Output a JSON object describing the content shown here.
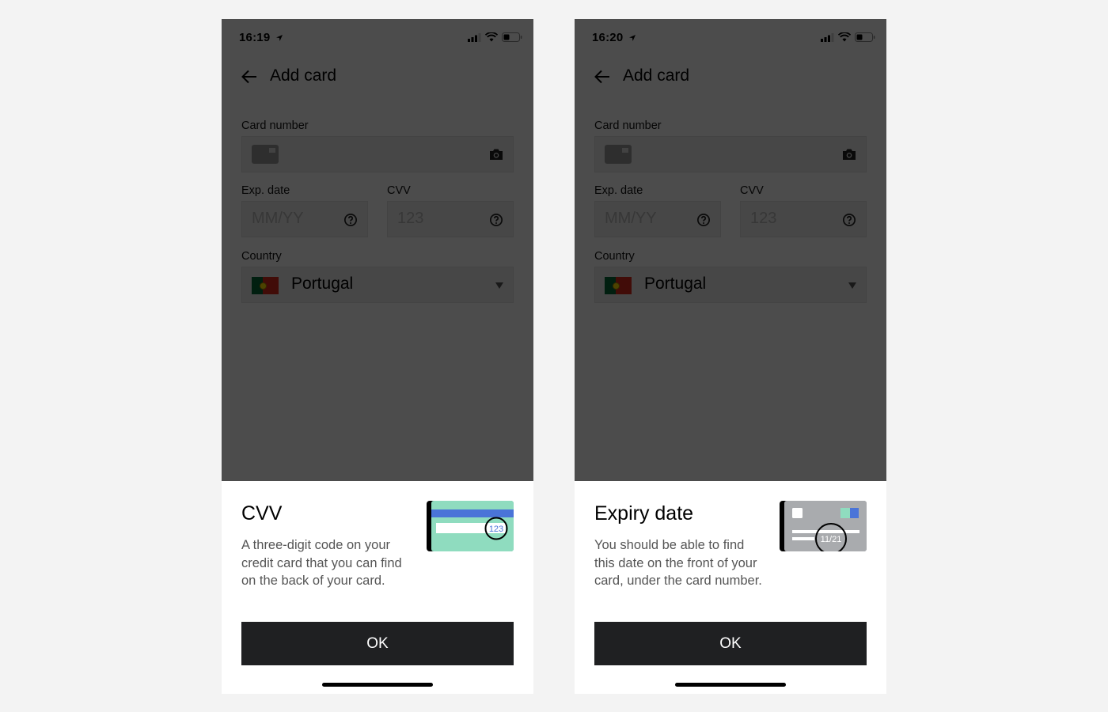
{
  "screens": [
    {
      "status": {
        "time": "16:19"
      },
      "nav": {
        "title": "Add card"
      },
      "form": {
        "card_number_label": "Card number",
        "exp_label": "Exp. date",
        "exp_placeholder": "MM/YY",
        "cvv_label": "CVV",
        "cvv_placeholder": "123",
        "country_label": "Country",
        "country_value": "Portugal"
      },
      "sheet": {
        "title": "CVV",
        "description": "A three-digit code on your credit card that you can find on the back of your card.",
        "illustration_text": "123",
        "ok_label": "OK"
      }
    },
    {
      "status": {
        "time": "16:20"
      },
      "nav": {
        "title": "Add card"
      },
      "form": {
        "card_number_label": "Card number",
        "exp_label": "Exp. date",
        "exp_placeholder": "MM/YY",
        "cvv_label": "CVV",
        "cvv_placeholder": "123",
        "country_label": "Country",
        "country_value": "Portugal"
      },
      "sheet": {
        "title": "Expiry date",
        "description": "You should be able to find this date on the front of your card, under the card number.",
        "illustration_text": "11/21",
        "ok_label": "OK"
      }
    }
  ],
  "colors": {
    "overlay": "#000000",
    "button": "#1f2022",
    "cvv_card_green": "#8fdcbf",
    "cvv_card_stripe": "#4a74d8",
    "expiry_card_gray": "#a9abae",
    "background": "#f3f3f3"
  },
  "icons": [
    "location-arrow-icon",
    "signal-icon",
    "wifi-icon",
    "battery-icon",
    "back-arrow-icon",
    "credit-card-icon",
    "camera-icon",
    "help-icon",
    "portugal-flag-icon",
    "chevron-down-icon"
  ]
}
